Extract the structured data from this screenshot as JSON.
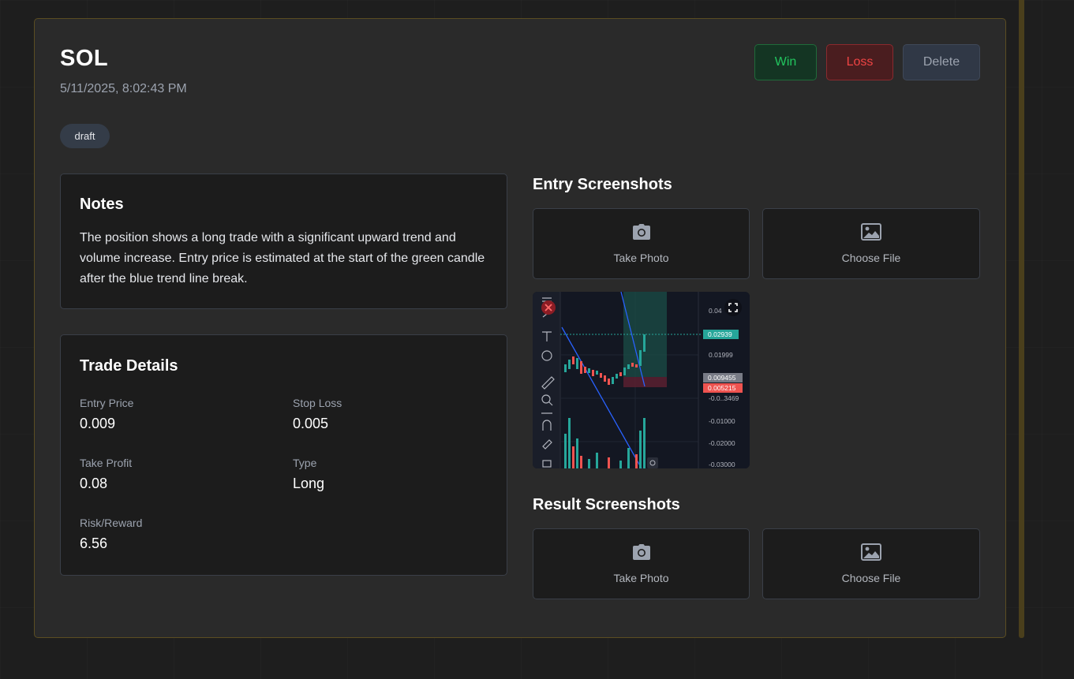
{
  "trade": {
    "symbol": "SOL",
    "date": "5/11/2025, 8:02:43 PM",
    "tag": "draft"
  },
  "actions": {
    "win": "Win",
    "loss": "Loss",
    "delete": "Delete"
  },
  "notes": {
    "title": "Notes",
    "text": "The position shows a long trade with a significant upward trend and volume increase. Entry price is estimated at the start of the green candle after the blue trend line break."
  },
  "details": {
    "title": "Trade Details",
    "entry_price_label": "Entry Price",
    "entry_price": "0.009",
    "stop_loss_label": "Stop Loss",
    "stop_loss": "0.005",
    "take_profit_label": "Take Profit",
    "take_profit": "0.08",
    "type_label": "Type",
    "type": "Long",
    "rr_label": "Risk/Reward",
    "rr": "6.56"
  },
  "entry_screens": {
    "title": "Entry Screenshots",
    "take_photo": "Take Photo",
    "choose_file": "Choose File"
  },
  "result_screens": {
    "title": "Result Screenshots",
    "take_photo": "Take Photo",
    "choose_file": "Choose File"
  },
  "thumbnail": {
    "price_labels": [
      "0.04",
      "0.02939",
      "0.01999",
      "0.009455",
      "0.005215",
      "-0.0..3469",
      "-0.01000",
      "-0.02000",
      "-0.03000"
    ],
    "colors": {
      "win": "#22c55e",
      "loss": "#ef4444",
      "accent_border": "#5b4d22"
    },
    "icons": [
      "close-icon",
      "fullscreen-icon"
    ]
  }
}
